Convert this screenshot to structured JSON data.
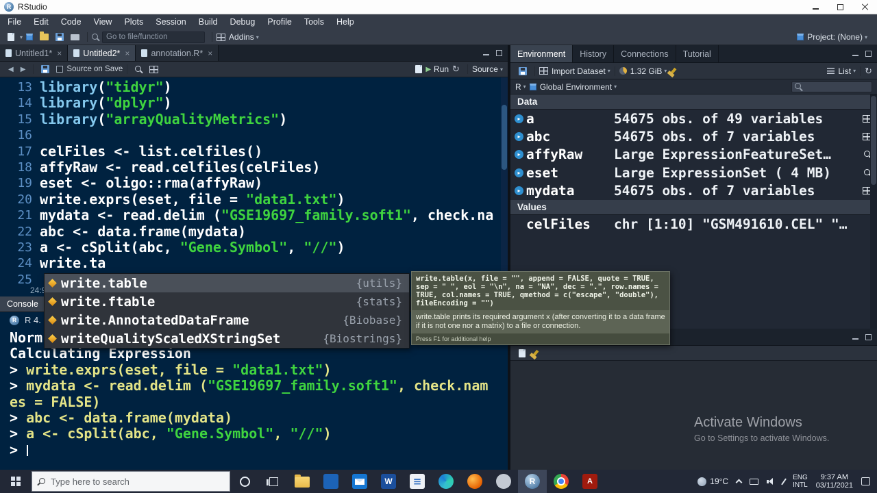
{
  "titlebar": {
    "app_title": "RStudio"
  },
  "menubar": {
    "items": [
      "File",
      "Edit",
      "Code",
      "View",
      "Plots",
      "Session",
      "Build",
      "Debug",
      "Profile",
      "Tools",
      "Help"
    ]
  },
  "main_toolbar": {
    "goto_placeholder": "Go to file/function",
    "addins_label": "Addins",
    "project_label": "Project: (None)"
  },
  "editor": {
    "tabs": [
      {
        "label": "Untitled1*",
        "active": false
      },
      {
        "label": "Untitled2*",
        "active": true
      },
      {
        "label": "annotation.R*",
        "active": false
      }
    ],
    "toolbar": {
      "source_on_save": "Source on Save",
      "run": "Run",
      "source": "Source"
    },
    "status_position": "24:9",
    "lines": [
      {
        "num": "13",
        "segs": [
          [
            "library",
            "fn"
          ],
          [
            "(",
            "pl"
          ],
          [
            "\"tidyr\"",
            "st"
          ],
          [
            ")",
            "pl"
          ]
        ]
      },
      {
        "num": "14",
        "segs": [
          [
            "library",
            "fn"
          ],
          [
            "(",
            "pl"
          ],
          [
            "\"dplyr\"",
            "st"
          ],
          [
            ")",
            "pl"
          ]
        ]
      },
      {
        "num": "15",
        "segs": [
          [
            "library",
            "fn"
          ],
          [
            "(",
            "pl"
          ],
          [
            "\"arrayQualityMetrics\"",
            "st"
          ],
          [
            ")",
            "pl"
          ]
        ]
      },
      {
        "num": "16",
        "segs": []
      },
      {
        "num": "17",
        "segs": [
          [
            "celFiles ",
            "pl"
          ],
          [
            "<- ",
            "op"
          ],
          [
            "list.celfiles()",
            "pl"
          ]
        ]
      },
      {
        "num": "18",
        "segs": [
          [
            "affyRaw ",
            "pl"
          ],
          [
            "<- ",
            "op"
          ],
          [
            "read.celfiles(celFiles)",
            "pl"
          ]
        ]
      },
      {
        "num": "19",
        "segs": [
          [
            "eset ",
            "pl"
          ],
          [
            "<- ",
            "op"
          ],
          [
            "oligo::rma(affyRaw)",
            "pl"
          ]
        ]
      },
      {
        "num": "20",
        "segs": [
          [
            "write.exprs(eset, file ",
            "pl"
          ],
          [
            "= ",
            "op"
          ],
          [
            "\"data1.txt\"",
            "st"
          ],
          [
            ")",
            "pl"
          ]
        ]
      },
      {
        "num": "21",
        "segs": [
          [
            "mydata ",
            "pl"
          ],
          [
            "<- ",
            "op"
          ],
          [
            "read.delim (",
            "pl"
          ],
          [
            "\"GSE19697_family.soft1\"",
            "st"
          ],
          [
            ", check.na",
            "pl"
          ]
        ]
      },
      {
        "num": "22",
        "segs": [
          [
            "abc ",
            "pl"
          ],
          [
            "<- ",
            "op"
          ],
          [
            "data.frame(mydata)",
            "pl"
          ]
        ]
      },
      {
        "num": "23",
        "segs": [
          [
            "a ",
            "pl"
          ],
          [
            "<- ",
            "op"
          ],
          [
            "cSplit(abc, ",
            "pl"
          ],
          [
            "\"Gene.Symbol\"",
            "st"
          ],
          [
            ", ",
            "pl"
          ],
          [
            "\"//\"",
            "st"
          ],
          [
            ")",
            "pl"
          ]
        ]
      },
      {
        "num": "24",
        "segs": [
          [
            "write.ta",
            "pl"
          ]
        ]
      },
      {
        "num": "25",
        "segs": []
      }
    ]
  },
  "autocomplete": {
    "items": [
      {
        "label": "write.table",
        "package": "{utils}",
        "selected": true
      },
      {
        "label": "write.ftable",
        "package": "{stats}",
        "selected": false
      },
      {
        "label": "write.AnnotatedDataFrame",
        "package": "{Biobase}",
        "selected": false
      },
      {
        "label": "writeQualityScaledXStringSet",
        "package": "{Biostrings}",
        "selected": false
      }
    ]
  },
  "tooltip": {
    "signature": "write.table(x, file = \"\", append = FALSE, quote = TRUE, sep = \" \", eol = \"\\n\", na = \"NA\", dec = \".\", row.names = TRUE, col.names = TRUE, qmethod = c(\"escape\", \"double\"), fileEncoding = \"\")",
    "description": "write.table prints its required argument x (after converting it to a data frame if it is not one nor a matrix) to a file or connection.",
    "footer": "Press F1 for additional help"
  },
  "console": {
    "tab_label": "Console",
    "header": "R 4.",
    "lines": [
      {
        "segs": [
          [
            "Norm",
            "pl"
          ]
        ]
      },
      {
        "segs": [
          [
            "Calculating Expression",
            "pl"
          ]
        ]
      },
      {
        "segs": [
          [
            "> ",
            "pl"
          ],
          [
            "write.exprs(eset, file = ",
            "cmd"
          ],
          [
            "\"data1.txt\"",
            "st"
          ],
          [
            ")",
            "cmd"
          ]
        ]
      },
      {
        "segs": [
          [
            "> ",
            "pl"
          ],
          [
            "mydata <- read.delim (",
            "cmd"
          ],
          [
            "\"GSE19697_family.soft1\"",
            "st"
          ],
          [
            ", check.nam",
            "cmd"
          ]
        ]
      },
      {
        "segs": [
          [
            "es = FALSE)",
            "cmd"
          ]
        ]
      },
      {
        "segs": [
          [
            "> ",
            "pl"
          ],
          [
            "abc <- data.frame(mydata)",
            "cmd"
          ]
        ]
      },
      {
        "segs": [
          [
            "> ",
            "pl"
          ],
          [
            "a <- cSplit(abc, ",
            "cmd"
          ],
          [
            "\"Gene.Symbol\"",
            "st"
          ],
          [
            ", ",
            "cmd"
          ],
          [
            "\"//\"",
            "st"
          ],
          [
            ")",
            "cmd"
          ]
        ]
      },
      {
        "segs": [
          [
            "> ",
            "pl"
          ]
        ],
        "cursor": true
      }
    ]
  },
  "environment": {
    "tabs": [
      {
        "label": "Environment",
        "active": true
      },
      {
        "label": "History",
        "active": false
      },
      {
        "label": "Connections",
        "active": false
      },
      {
        "label": "Tutorial",
        "active": false
      }
    ],
    "toolbar": {
      "import_label": "Import Dataset",
      "memory": "1.32 GiB",
      "view_label": "List"
    },
    "scope_r": "R",
    "scope_label": "Global Environment",
    "sections": [
      {
        "title": "Data",
        "rows": [
          {
            "name": "a",
            "value": "54675 obs. of 49 variables",
            "action": "grid",
            "expandable": true
          },
          {
            "name": "abc",
            "value": "54675 obs. of 7 variables",
            "action": "grid",
            "expandable": true
          },
          {
            "name": "affyRaw",
            "value": "Large ExpressionFeatureSet…",
            "action": "magnifier",
            "expandable": true
          },
          {
            "name": "eset",
            "value": "Large ExpressionSet ( 4 MB)",
            "action": "magnifier",
            "expandable": true
          },
          {
            "name": "mydata",
            "value": "54675 obs. of 7 variables",
            "action": "grid",
            "expandable": true
          }
        ]
      },
      {
        "title": "Values",
        "rows": [
          {
            "name": "celFiles",
            "value": "chr [1:10] \"GSM491610.CEL\" \"…",
            "action": null,
            "expandable": false
          }
        ]
      }
    ]
  },
  "watermark": {
    "line1": "Activate Windows",
    "line2": "Go to Settings to activate Windows."
  },
  "taskbar": {
    "search_placeholder": "Type here to search",
    "apps": [
      {
        "name": "file-explorer",
        "kind": "folder"
      },
      {
        "name": "blue-app",
        "kind": "blue-square"
      },
      {
        "name": "mail-app",
        "kind": "mail"
      },
      {
        "name": "word-app",
        "kind": "word",
        "letter": "W"
      },
      {
        "name": "doc-app",
        "kind": "doc"
      },
      {
        "name": "edge-browser",
        "kind": "edge"
      },
      {
        "name": "firefox-browser",
        "kind": "firefox"
      },
      {
        "name": "gray-app",
        "kind": "gray-circle"
      },
      {
        "name": "rstudio-app",
        "kind": "rstudio",
        "letter": "R",
        "active": true
      },
      {
        "name": "chrome-browser",
        "kind": "chrome"
      },
      {
        "name": "acrobat-app",
        "kind": "acrobat",
        "letter": "A"
      }
    ],
    "tray": {
      "temperature": "19°C",
      "lang_line1": "ENG",
      "lang_line2": "INTL",
      "time": "9:37 AM",
      "date": "03/11/2021"
    }
  }
}
